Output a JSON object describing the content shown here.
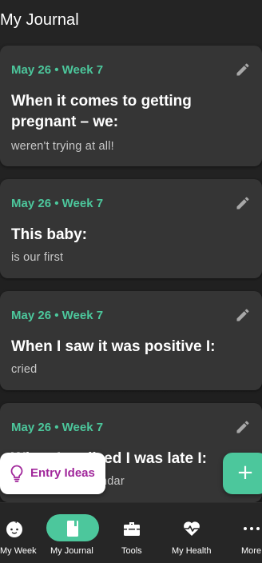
{
  "header": {
    "title": "My Journal"
  },
  "entries": [
    {
      "date": "May 26 • Week 7",
      "prompt": "When it comes to getting pregnant – we:",
      "answer": "weren't trying at all!"
    },
    {
      "date": "May 26 • Week 7",
      "prompt": "This baby:",
      "answer": "is our first"
    },
    {
      "date": "May 26 • Week 7",
      "prompt": "When I saw it was positive I:",
      "answer": "cried"
    },
    {
      "date": "May 26 • Week 7",
      "prompt": "When I realized I was late I:",
      "answer": "checked the calendar"
    }
  ],
  "entry_ideas": {
    "label": "Entry Ideas"
  },
  "fab": {
    "symbol": "+"
  },
  "nav": {
    "items": [
      {
        "label": "My Week",
        "icon": "baby-face-icon"
      },
      {
        "label": "My Journal",
        "icon": "journal-book-icon",
        "active": true
      },
      {
        "label": "Tools",
        "icon": "toolbox-icon"
      },
      {
        "label": "My Health",
        "icon": "heart-pulse-icon"
      },
      {
        "label": "More",
        "icon": "more-dots-icon"
      }
    ]
  },
  "colors": {
    "accent": "#4cc79c",
    "card": "#353535",
    "background": "#1f1f1f",
    "ideas_text": "#a1279b"
  }
}
